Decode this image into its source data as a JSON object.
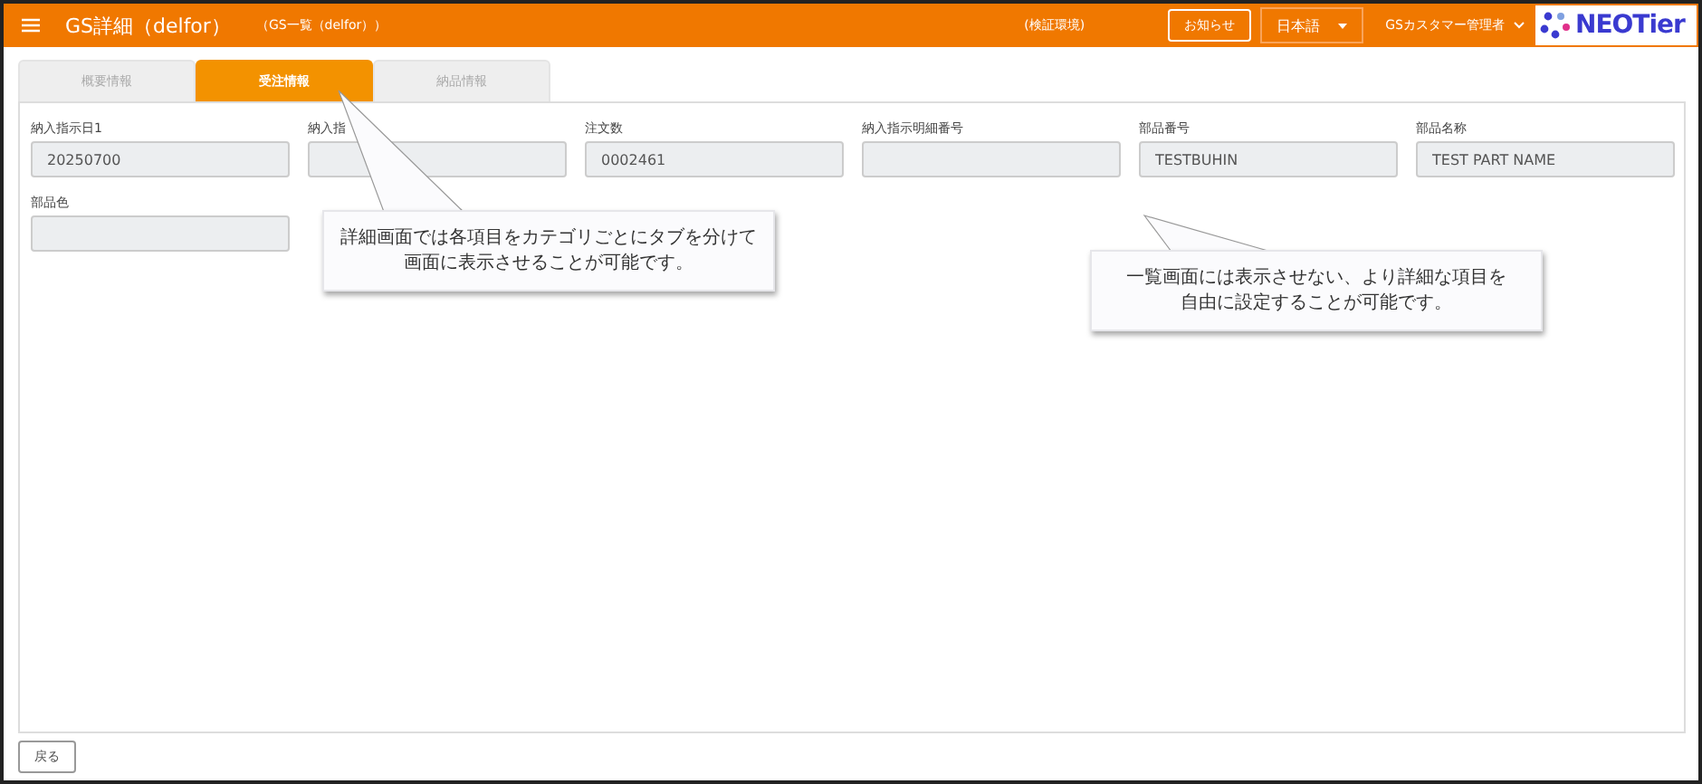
{
  "header": {
    "title": "GS詳細（delfor）",
    "breadcrumb": "（GS一覧（delfor））",
    "environment": "(検証環境)",
    "notice_button": "お知らせ",
    "language": "日本語",
    "user": "GSカスタマー管理者",
    "logo": "NEOTier"
  },
  "tabs": [
    {
      "label": "概要情報",
      "selected": false
    },
    {
      "label": "受注情報",
      "selected": true
    },
    {
      "label": "納品情報",
      "selected": false
    }
  ],
  "fields": [
    {
      "label": "納入指示日1",
      "value": "20250700"
    },
    {
      "label": "納入指"
    },
    {
      "label": "注文数",
      "value": "0002461"
    },
    {
      "label": "納入指示明細番号"
    },
    {
      "label": "部品番号",
      "value": "TESTBUHIN"
    },
    {
      "label": "部品名称",
      "value": "TEST PART NAME"
    },
    {
      "label": "部品色"
    }
  ],
  "callouts": [
    {
      "lines": [
        "詳細画面では各項目をカテゴリごとにタブを分けて",
        "画面に表示させることが可能です。"
      ]
    },
    {
      "lines": [
        "一覧画面には表示させない、より詳細な項目を",
        "自由に設定することが可能です。"
      ]
    }
  ],
  "back_button": "戻る"
}
